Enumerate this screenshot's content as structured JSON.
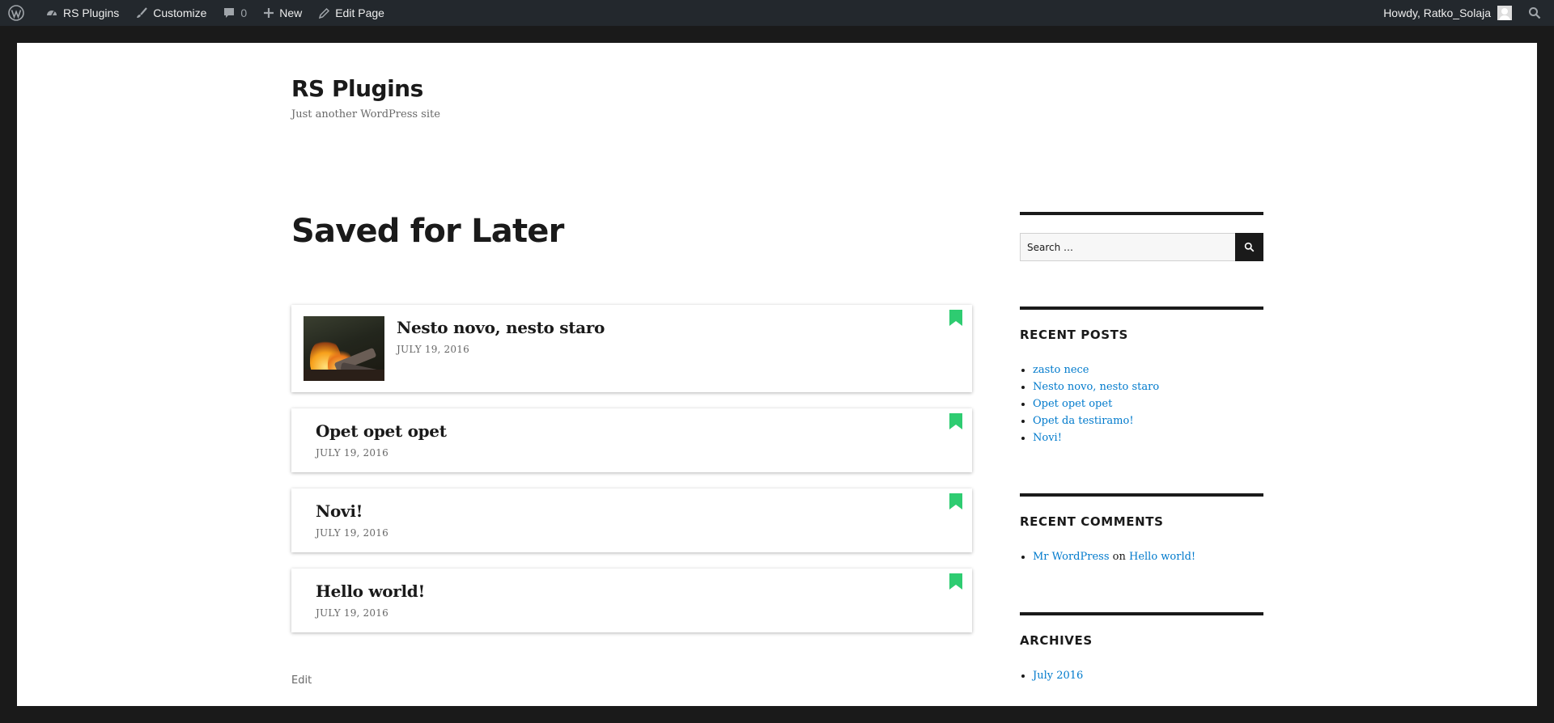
{
  "adminbar": {
    "site_name": "RS Plugins",
    "customize": "Customize",
    "comments_count": "0",
    "new": "New",
    "edit_page": "Edit Page",
    "howdy": "Howdy, Ratko_Solaja"
  },
  "site": {
    "title": "RS Plugins",
    "description": "Just another WordPress site"
  },
  "page": {
    "title": "Saved for Later",
    "edit": "Edit"
  },
  "saved_posts": [
    {
      "title": "Nesto novo, nesto staro",
      "date": "JULY 19, 2016",
      "has_thumbnail": true
    },
    {
      "title": "Opet opet opet",
      "date": "JULY 19, 2016",
      "has_thumbnail": false
    },
    {
      "title": "Novi!",
      "date": "JULY 19, 2016",
      "has_thumbnail": false
    },
    {
      "title": "Hello world!",
      "date": "JULY 19, 2016",
      "has_thumbnail": false
    }
  ],
  "sidebar": {
    "search_placeholder": "Search …",
    "recent_posts_title": "RECENT POSTS",
    "recent_posts": [
      "zasto nece",
      "Nesto novo, nesto staro",
      "Opet opet opet",
      "Opet da testiramo!",
      "Novi!"
    ],
    "recent_comments_title": "RECENT COMMENTS",
    "recent_comment": {
      "author": "Mr WordPress",
      "on": "on",
      "post": "Hello world!"
    },
    "archives_title": "ARCHIVES",
    "archives": [
      "July 2016"
    ]
  },
  "colors": {
    "bookmark": "#2ecc71",
    "link": "#007acc",
    "adminbar": "#23282d"
  }
}
